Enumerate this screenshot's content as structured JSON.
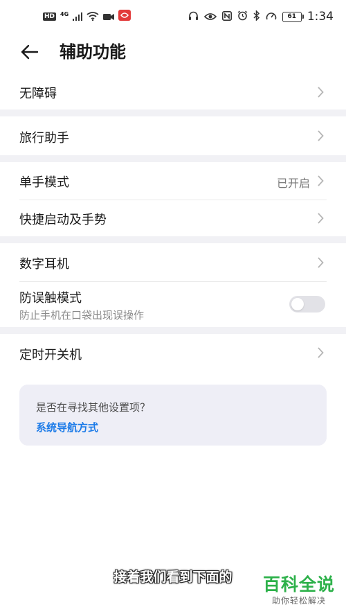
{
  "status_bar": {
    "badges": [
      "HD",
      "4G"
    ],
    "battery": "61",
    "time": "1:34"
  },
  "header": {
    "title": "辅助功能"
  },
  "items": [
    {
      "label": "无障碍"
    },
    {
      "label": "旅行助手"
    },
    {
      "label": "单手模式",
      "value": "已开启"
    },
    {
      "label": "快捷启动及手势"
    },
    {
      "label": "数字耳机"
    },
    {
      "label": "防误触模式",
      "sublabel": "防止手机在口袋出现误操作",
      "toggle_on": false
    },
    {
      "label": "定时开关机"
    }
  ],
  "suggestion": {
    "question": "是否在寻找其他设置项？",
    "link": "系统导航方式"
  },
  "subtitle": "接着我们看到下面的",
  "watermark": {
    "title": "百科全说",
    "subtitle": "助你轻松解决"
  },
  "colors": {
    "accent": "#1c7be8",
    "watermark_green": "#2db14a",
    "separator": "#f1f1f5",
    "card": "#eeeef6"
  }
}
